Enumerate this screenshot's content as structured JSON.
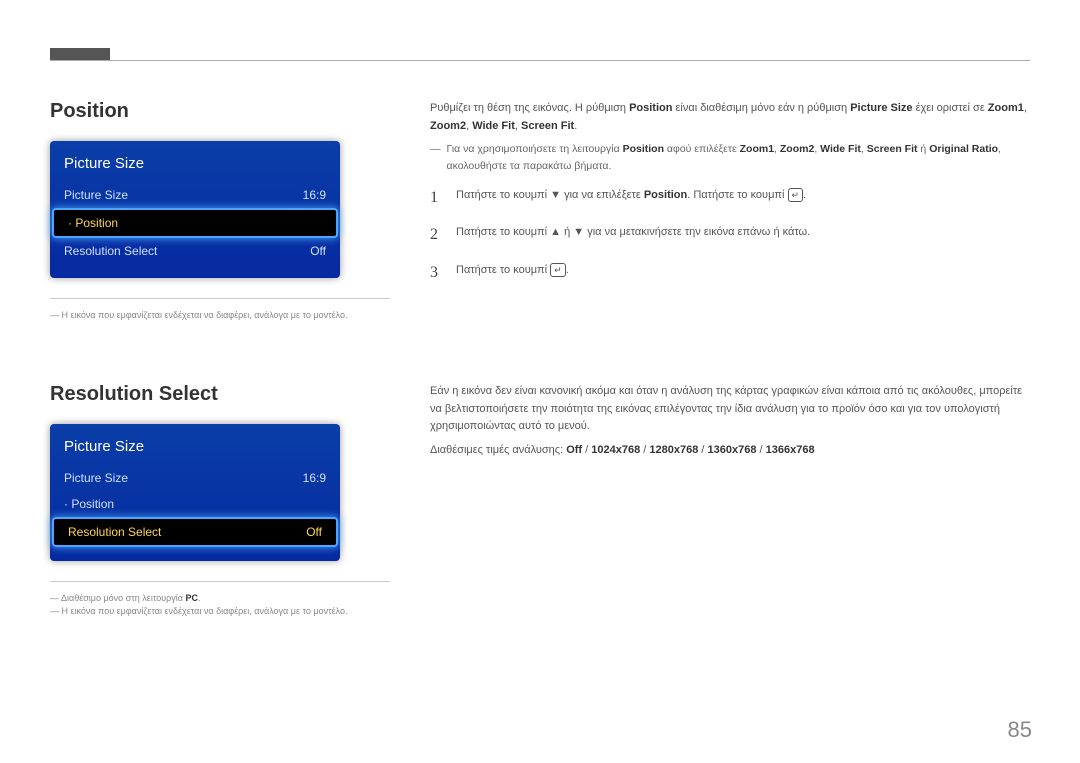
{
  "page_number": "85",
  "section1": {
    "title": "Position",
    "osd": {
      "header": "Picture Size",
      "rows": [
        {
          "label": "Picture Size",
          "value": "16:9",
          "selected": false,
          "dot": false
        },
        {
          "label": "Position",
          "value": "",
          "selected": true,
          "dot": true
        },
        {
          "label": "Resolution Select",
          "value": "Off",
          "selected": false,
          "dot": false
        }
      ]
    },
    "footnotes": [
      {
        "pre": "Η εικόνα που εμφανίζεται ενδέχεται να διαφέρει, ανάλογα με το μοντέλο.",
        "accent": ""
      }
    ],
    "intro_a": "Ρυθμίζει τη θέση της εικόνας. Η ρύθμιση ",
    "intro_b": "Position",
    "intro_c": " είναι διαθέσιμη μόνο εάν η ρύθμιση ",
    "intro_d": "Picture Size",
    "intro_e": " έχει οριστεί σε ",
    "intro_f": "Zoom1",
    "intro_g": "Zoom2",
    "intro_h": "Wide Fit",
    "intro_i": "Screen Fit",
    "note_a": "Για να χρησιμοποιήσετε τη λειτουργία ",
    "note_b": "Position",
    "note_c": " αφού επιλέξετε ",
    "note_d": "Zoom1",
    "note_e": "Zoom2",
    "note_f": "Wide Fit",
    "note_g": "Screen Fit",
    "note_h": " ή ",
    "note_i": "Original Ratio",
    "note_j": ", ακολουθήστε τα παρακάτω βήματα.",
    "steps": {
      "s1a": "Πατήστε το κουμπί ▼ για να επιλέξετε ",
      "s1b": "Position",
      "s1c": ". Πατήστε το κουμπί ",
      "s2": "Πατήστε το κουμπί ▲ ή ▼ για να μετακινήσετε την εικόνα επάνω ή κάτω.",
      "s3": "Πατήστε το κουμπί "
    },
    "num1": "1",
    "num2": "2",
    "num3": "3"
  },
  "section2": {
    "title": "Resolution Select",
    "osd": {
      "header": "Picture Size",
      "rows": [
        {
          "label": "Picture Size",
          "value": "16:9",
          "selected": false,
          "dot": false
        },
        {
          "label": "Position",
          "value": "",
          "selected": false,
          "dot": true
        },
        {
          "label": "Resolution Select",
          "value": "Off",
          "selected": true,
          "dot": false
        }
      ]
    },
    "footnotes": [
      {
        "pre": "Διαθέσιμο μόνο στη λειτουργία ",
        "accent": "PC",
        "post": "."
      },
      {
        "pre": "Η εικόνα που εμφανίζεται ενδέχεται να διαφέρει, ανάλογα με το μοντέλο.",
        "accent": ""
      }
    ],
    "body": "Εάν η εικόνα δεν είναι κανονική ακόμα και όταν η ανάλυση της κάρτας γραφικών είναι κάποια από τις ακόλουθες, μπορείτε να βελτιστοποιήσετε την ποιότητα της εικόνας επιλέγοντας την ίδια ανάλυση για το προϊόν όσο και για τον υπολογιστή χρησιμοποιώντας αυτό το μενού.",
    "avail_label": "Διαθέσιμες τιμές ανάλυσης: ",
    "avail_values": [
      "Off",
      "1024x768",
      "1280x768",
      "1360x768",
      "1366x768"
    ],
    "sep": " / "
  }
}
